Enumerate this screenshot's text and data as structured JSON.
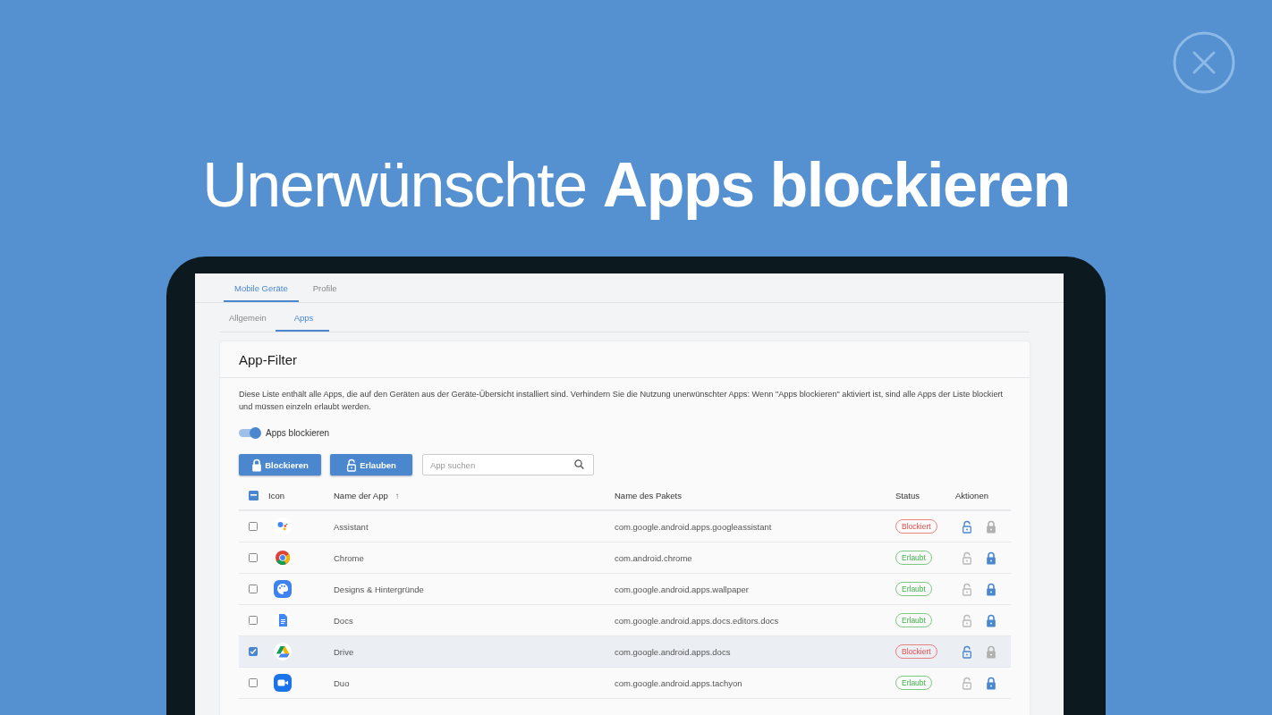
{
  "headline": "Unerwünschte **Apps blockieren**",
  "tabs": [
    {
      "label": "Mobile Geräte",
      "selected": true
    },
    {
      "label": "Profile",
      "selected": false
    }
  ],
  "subtabs": [
    {
      "label": "Allgemein",
      "selected": false
    },
    {
      "label": "Apps",
      "selected": true
    }
  ],
  "card": {
    "title": "App-Filter",
    "description": "Diese Liste enthält alle Apps, die auf den Geräten aus der Geräte-Übersicht installiert sind. Verhindern Sie die Nutzung unerwünschter Apps: Wenn \"Apps blockieren\" aktiviert ist, sind alle Apps der Liste blockiert und müssen einzeln erlaubt werden.",
    "toggle": {
      "label": "Apps blockieren",
      "on": true
    },
    "buttons": [
      {
        "label": "Blockieren",
        "kind": "lock"
      },
      {
        "label": "Erlauben",
        "kind": "unlock"
      }
    ],
    "search": {
      "placeholder": "App suchen"
    },
    "table": {
      "select_all": {
        "indeterminate": true
      },
      "columns": [
        "Icon",
        "Name der App",
        "Name des Pakets",
        "Status",
        "Aktionen"
      ],
      "sort_arrow": "↑",
      "rows": [
        {
          "checked": false,
          "name": "Assistant",
          "package": "com.google.android.apps.googleassistant",
          "status": "Blockiert",
          "blocked": true
        },
        {
          "checked": false,
          "name": "Chrome",
          "package": "com.android.chrome",
          "status": "Erlaubt",
          "blocked": false
        },
        {
          "checked": false,
          "name": "Designs & Hintergründe",
          "package": "com.google.android.apps.wallpaper",
          "status": "Erlaubt",
          "blocked": false
        },
        {
          "checked": false,
          "name": "Docs",
          "package": "com.google.android.apps.docs.editors.docs",
          "status": "Erlaubt",
          "blocked": false
        },
        {
          "checked": true,
          "name": "Drive",
          "package": "com.google.android.apps.docs",
          "status": "Blockiert",
          "blocked": true
        },
        {
          "checked": false,
          "name": "Duo",
          "package": "com.google.android.apps.tachyon",
          "status": "Erlaubt",
          "blocked": false
        }
      ]
    }
  }
}
